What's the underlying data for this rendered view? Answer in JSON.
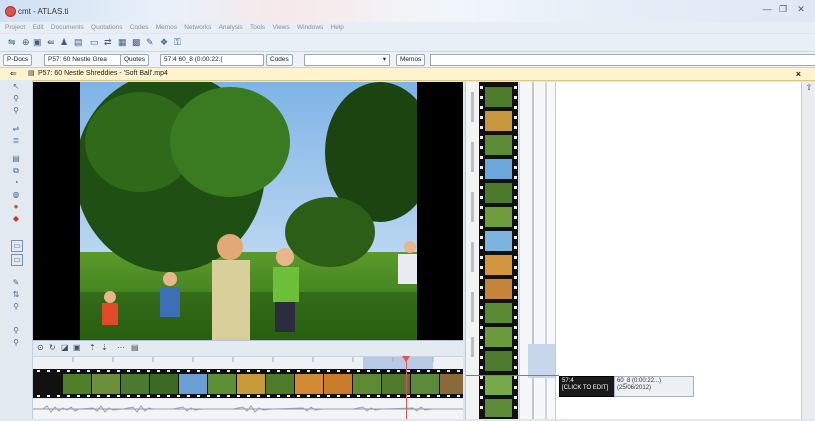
{
  "window": {
    "title": "cmt - ATLAS.ti",
    "min": "—",
    "max": "❐",
    "close": "✕"
  },
  "menu": [
    "Project",
    "Edit",
    "Documents",
    "Quotations",
    "Codes",
    "Memos",
    "Networks",
    "Analysis",
    "Tools",
    "Views",
    "Windows",
    "Help"
  ],
  "toolbar": {
    "p_docs": "P-Docs",
    "document_combo": "P57: 60 Nestle Grea",
    "quotes_label": "Quotes",
    "quote_combo": "57:4 60_8 (0:00:22.(",
    "codes_label": "Codes",
    "memos_label": "Memos"
  },
  "document": {
    "title": "P57: 60 Nestle Shreddies - 'Soft Ball'.mp4",
    "close": "×"
  },
  "quote": {
    "id": "57:4",
    "hint": "[CLICK TO EDIT]",
    "info_line1": "60_8 (0:00:22...)",
    "info_line2": "(25/06/2012)"
  },
  "colors": {
    "doc_bar": "#fdf3cf",
    "playhead": "#e45151",
    "selection": "#b7c9e6"
  },
  "icons": {
    "media_controls": [
      "play-icon",
      "loop-icon",
      "volume-icon",
      "snapshot-icon",
      "zoom-in-icon",
      "zoom-out-icon",
      "more-icon",
      "settings-icon"
    ],
    "left_tools": [
      "pointer-icon",
      "zoom-icon",
      "search-icon",
      "code-icon",
      "list-icon",
      "memo-icon",
      "link-icon",
      "open-icon",
      "filter-icon",
      "red-code-icon",
      "assign-icon",
      "edit-icon",
      "network-icon",
      "quote-icon",
      "search-small-icon",
      "magnify-icon"
    ]
  }
}
